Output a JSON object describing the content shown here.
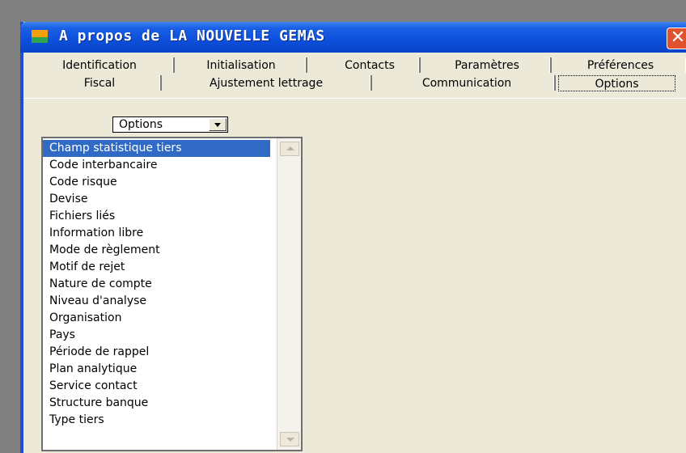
{
  "window": {
    "title": "A propos de LA NOUVELLE GEMAS",
    "close_label": "✕"
  },
  "tabs_row1": [
    "Identification",
    "Initialisation",
    "Contacts",
    "Paramètres",
    "Préférences"
  ],
  "tabs_row2": [
    "Fiscal",
    "Ajustement lettrage",
    "Communication",
    "Options"
  ],
  "active_tab": "Options",
  "dropdown": {
    "value": "Options"
  },
  "list": {
    "selected": "Champ statistique tiers",
    "items": [
      "Champ statistique tiers",
      "Code interbancaire",
      "Code risque",
      "Devise",
      "Fichiers liés",
      "Information libre",
      "Mode de règlement",
      "Motif de rejet",
      "Nature de compte",
      "Niveau d'analyse",
      "Organisation",
      "Pays",
      "Période de rappel",
      "Plan analytique",
      "Service contact",
      "Structure banque",
      "Type tiers"
    ]
  },
  "colors": {
    "titlebar": "#0c4fdb",
    "selection": "#316ac5",
    "window_bg": "#ece9d8"
  },
  "icons": {
    "app": "app-icon",
    "close": "close-icon"
  }
}
